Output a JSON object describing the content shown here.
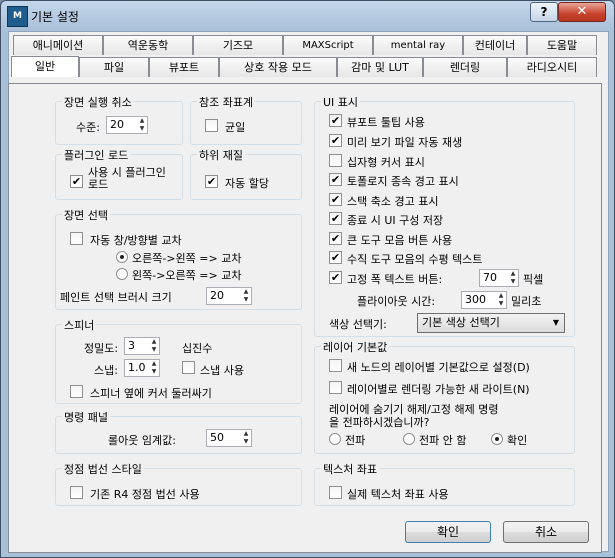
{
  "window": {
    "title": "기본 설정",
    "app_icon_text": "M",
    "help_label": "?",
    "close_label": "✕"
  },
  "tabs_row1": [
    "애니메이션",
    "역운동학",
    "기즈모",
    "MAXScript",
    "mental ray",
    "컨테이너",
    "도움말"
  ],
  "tabs_row2": [
    "일반",
    "파일",
    "뷰포트",
    "상호 작용 모드",
    "감마 및 LUT",
    "렌더링",
    "라디오시티"
  ],
  "active_tab": "일반",
  "scene_undo": {
    "title": "장면 실행 취소",
    "levels_label": "수준:",
    "levels_value": "20"
  },
  "ref_coords": {
    "title": "참조 좌표계",
    "uniform_label": "균일",
    "uniform_checked": false
  },
  "plugin_load": {
    "title": "플러그인 로드",
    "load_on_use_label": "사용 시 플러그인 로드",
    "load_on_use_checked": true
  },
  "sub_materials": {
    "title": "하위 재질",
    "auto_assign_label": "자동 할당",
    "auto_assign_checked": true
  },
  "scene_selection": {
    "title": "장면 선택",
    "auto_cross_label": "자동 창/방향별 교차",
    "auto_cross_checked": false,
    "right_left_label": "오른쪽->왼쪽 => 교차",
    "right_left_selected": true,
    "left_right_label": "왼쪽->오른쪽 => 교차",
    "left_right_selected": false,
    "brush_size_label": "페인트 선택 브러시 크기",
    "brush_size_value": "20"
  },
  "spinners": {
    "title": "스피너",
    "precision_label": "정밀도:",
    "precision_value": "3",
    "decimal_label": "십진수",
    "snap_label": "스냅:",
    "snap_value": "1.0",
    "use_snap_label": "스냅 사용",
    "use_snap_checked": false,
    "wrap_cursor_label": "스피너 옆에 커서 둘러싸기",
    "wrap_cursor_checked": false
  },
  "command_panel": {
    "title": "명령 패널",
    "rollout_label": "롤아웃 임계값:",
    "rollout_value": "50"
  },
  "vertex_normal": {
    "title": "정점 법선 스타일",
    "legacy_label": "기존 R4 정점 법선 사용",
    "legacy_checked": false
  },
  "ui_display": {
    "title": "UI 표시",
    "items": [
      {
        "label": "뷰포트 툴팁 사용",
        "checked": true
      },
      {
        "label": "미리 보기 파일 자동 재생",
        "checked": true
      },
      {
        "label": "십자형 커서 표시",
        "checked": false
      },
      {
        "label": "토폴로지 종속 경고 표시",
        "checked": true
      },
      {
        "label": "스택 축소 경고 표시",
        "checked": true
      },
      {
        "label": "종료 시 UI 구성 저장",
        "checked": true
      },
      {
        "label": "큰 도구 모음 버튼 사용",
        "checked": true
      },
      {
        "label": "수직 도구 모음의 수평 텍스트",
        "checked": true
      }
    ],
    "fixed_width_label": "고정 폭 텍스트 버튼:",
    "fixed_width_checked": true,
    "fixed_width_value": "70",
    "pixel_unit": "픽셀",
    "flyout_label": "플라이아웃 시간:",
    "flyout_value": "300",
    "ms_unit": "밀리초",
    "color_selector_label": "색상 선택기:",
    "color_selector_value": "기본 색상 선택기"
  },
  "layer_defaults": {
    "title": "레이어 기본값",
    "new_nodes_label": "새 노드의 레이어별 기본값으로 설정(D)",
    "new_nodes_checked": false,
    "new_lights_label": "레이어별로 렌더링 가능한 새 라이트(N)",
    "new_lights_checked": false,
    "propagate_question": "레이어에 숨기기 해제/고정 해제 명령\n을 전파하시겠습니까?",
    "opt_all": "전파",
    "opt_none": "전파 안 함",
    "opt_ask": "확인",
    "selected": "ask"
  },
  "texture_coords": {
    "title": "텍스처 좌표",
    "real_world_label": "실제 텍스처 좌표 사용",
    "real_world_checked": false
  },
  "buttons": {
    "ok": "확인",
    "cancel": "취소"
  },
  "colors": {
    "title_bar": "#a9c0d9",
    "close_button": "#c7432e",
    "panel": "#f0f0f0"
  }
}
